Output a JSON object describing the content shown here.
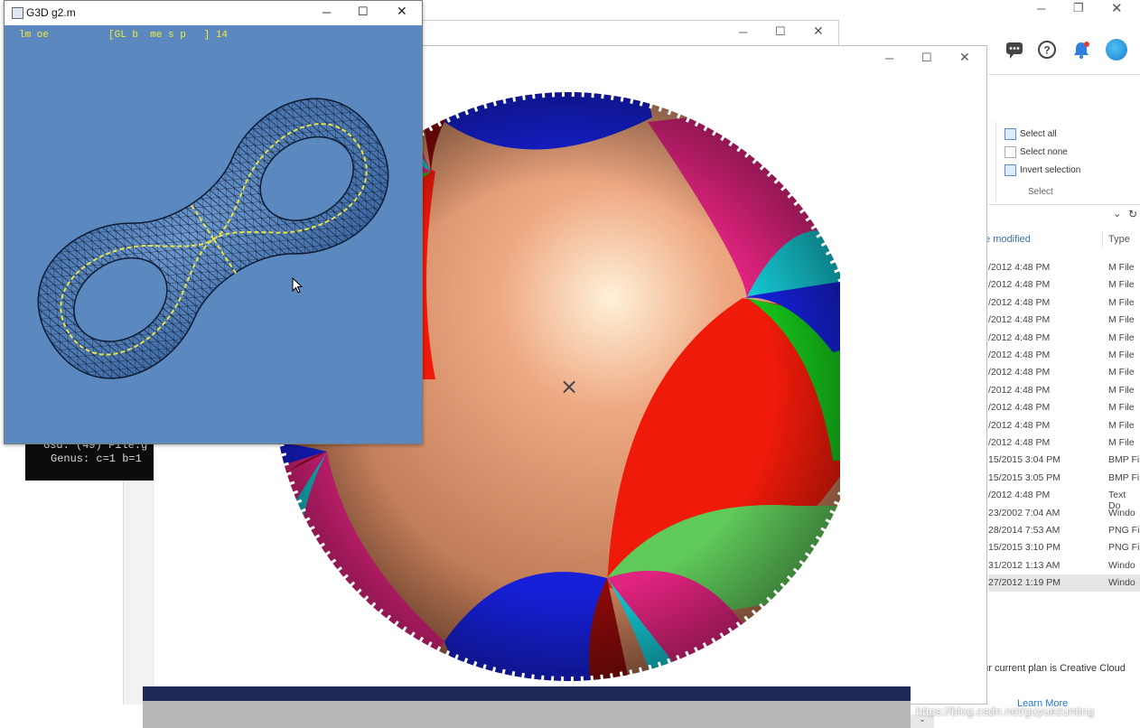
{
  "explorer": {
    "select_group": {
      "items": [
        "Select all",
        "Select none",
        "Invert selection"
      ],
      "label": "Select"
    },
    "columns": {
      "date": "te modified",
      "type": "Type"
    },
    "rows": [
      {
        "date": "/2012 4:48 PM",
        "type": "M File"
      },
      {
        "date": "/2012 4:48 PM",
        "type": "M File"
      },
      {
        "date": "/2012 4:48 PM",
        "type": "M File"
      },
      {
        "date": "/2012 4:48 PM",
        "type": "M File"
      },
      {
        "date": "/2012 4:48 PM",
        "type": "M File"
      },
      {
        "date": "/2012 4:48 PM",
        "type": "M File"
      },
      {
        "date": "/2012 4:48 PM",
        "type": "M File"
      },
      {
        "date": "/2012 4:48 PM",
        "type": "M File"
      },
      {
        "date": "/2012 4:48 PM",
        "type": "M File"
      },
      {
        "date": "/2012 4:48 PM",
        "type": "M File"
      },
      {
        "date": "/2012 4:48 PM",
        "type": "M File"
      },
      {
        "date": "15/2015 3:04 PM",
        "type": "BMP Fi"
      },
      {
        "date": "15/2015 3:05 PM",
        "type": "BMP Fi"
      },
      {
        "date": "/2012 4:48 PM",
        "type": "Text Do"
      },
      {
        "date": "23/2002 7:04 AM",
        "type": "Windo"
      },
      {
        "date": "28/2014 7:53 AM",
        "type": "PNG Fi"
      },
      {
        "date": "15/2015 3:10 PM",
        "type": "PNG Fi"
      },
      {
        "date": "31/2012 1:13 AM",
        "type": "Windo"
      },
      {
        "date": "27/2012 1:19 PM",
        "type": "Windo"
      }
    ],
    "promo": {
      "text": "ur current plan is Creative Cloud",
      "link": "Learn More"
    },
    "colors": {
      "accent": "#1e78d6",
      "bell": "#2f7fe0"
    }
  },
  "g3d": {
    "title": "G3D g2.m",
    "status": "lm oe          [GL b  me s p   ] 14",
    "bg": "#5b88bf",
    "mesh_color": "#0d1b33",
    "curve_color": "#e6e24a"
  },
  "console": {
    "lines": [
      "Gsd: (49) File:g",
      "Genus: c=1 b=1"
    ]
  },
  "tiling": {
    "center_marker": "×",
    "colors": {
      "base": "#d9906a",
      "red": "#ef1a0a",
      "green": "#16c21a",
      "blue": "#1620d8",
      "pink": "#e0237e",
      "cyan": "#14c6d1",
      "dark_red": "#8a0a0a"
    }
  },
  "watermark": "https://blog.csdn.net/guyuezunting"
}
